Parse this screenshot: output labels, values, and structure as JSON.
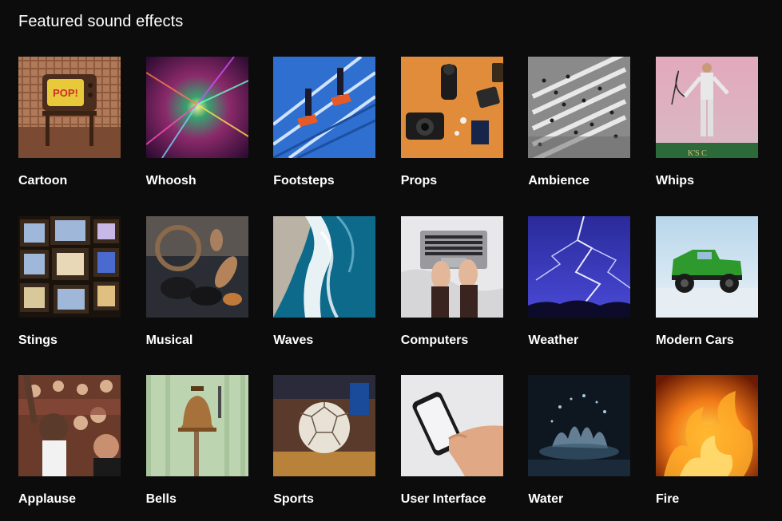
{
  "section": {
    "title": "Featured sound effects"
  },
  "categories": [
    {
      "label": "Cartoon",
      "icon": "retro-tv-pop-image"
    },
    {
      "label": "Whoosh",
      "icon": "light-tunnel-image"
    },
    {
      "label": "Footsteps",
      "icon": "stairs-sneakers-image"
    },
    {
      "label": "Props",
      "icon": "camera-gear-flatlay-image"
    },
    {
      "label": "Ambience",
      "icon": "crowd-crosswalk-image"
    },
    {
      "label": "Whips",
      "icon": "man-with-whip-image"
    },
    {
      "label": "Stings",
      "icon": "stacked-tvs-image"
    },
    {
      "label": "Musical",
      "icon": "percussion-instruments-image"
    },
    {
      "label": "Waves",
      "icon": "ocean-waves-image"
    },
    {
      "label": "Computers",
      "icon": "laptop-typing-image"
    },
    {
      "label": "Weather",
      "icon": "lightning-storm-image"
    },
    {
      "label": "Modern Cars",
      "icon": "green-truck-image"
    },
    {
      "label": "Applause",
      "icon": "cheering-crowd-image"
    },
    {
      "label": "Bells",
      "icon": "hanging-bell-image"
    },
    {
      "label": "Sports",
      "icon": "football-ball-image"
    },
    {
      "label": "User Interface",
      "icon": "smartphone-hand-image"
    },
    {
      "label": "Water",
      "icon": "water-splash-image"
    },
    {
      "label": "Fire",
      "icon": "fire-flames-image"
    }
  ]
}
